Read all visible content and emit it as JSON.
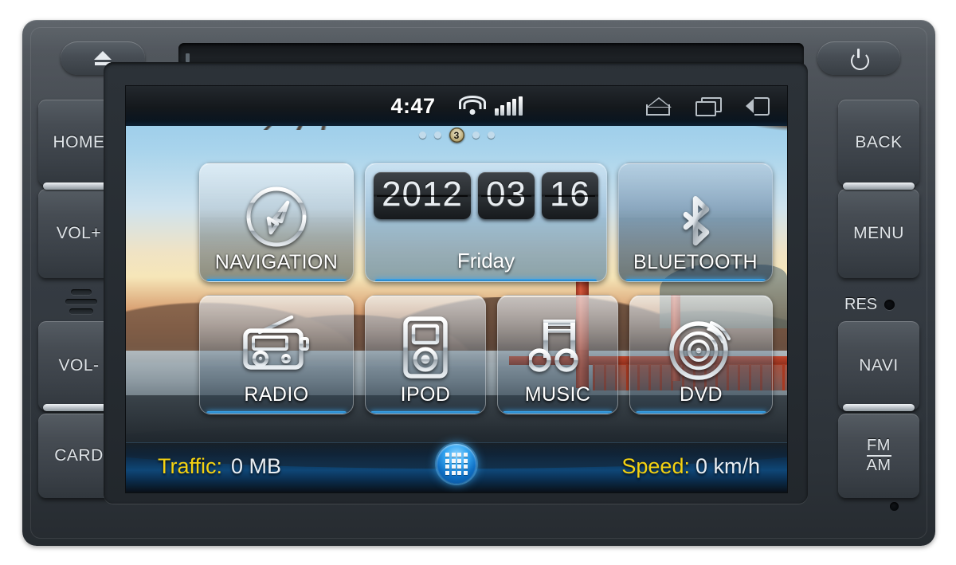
{
  "device": {
    "top_bar": {
      "eject_label": "eject-icon",
      "power_label": "power-icon",
      "disc_slot": "disc-slot"
    },
    "left_buttons": [
      {
        "label": "HOME"
      },
      {
        "label": "VOL+"
      },
      {
        "label": "VOL-"
      },
      {
        "label": "CARD"
      }
    ],
    "right_buttons": [
      {
        "label": "BACK"
      },
      {
        "label": "MENU"
      },
      {
        "label": "NAVI"
      },
      {
        "label": "FM",
        "label2": "AM"
      }
    ],
    "reset": {
      "label": "RES"
    }
  },
  "screen": {
    "statusbar": {
      "time": "4:47",
      "wifi_icon": "wifi-icon",
      "signal_icon": "signal-bars-icon",
      "signal_bars": [
        9,
        13,
        17,
        21,
        24
      ],
      "home_icon": "home-icon",
      "recent_icon": "recent-apps-icon",
      "back_icon": "back-icon"
    },
    "page_indicator": {
      "total": 5,
      "current": 3,
      "current_label": "3"
    },
    "tiles": [
      {
        "id": "navigation",
        "label": "NAVIGATION",
        "icon": "compass-icon"
      },
      {
        "id": "date",
        "label": "",
        "icon": "flip-clock-widget"
      },
      {
        "id": "bluetooth",
        "label": "BLUETOOTH",
        "icon": "bluetooth-icon"
      },
      {
        "id": "radio",
        "label": "RADIO",
        "icon": "radio-icon"
      },
      {
        "id": "ipod",
        "label": "IPOD",
        "icon": "ipod-icon"
      },
      {
        "id": "music",
        "label": "MUSIC",
        "icon": "music-note-icon"
      },
      {
        "id": "dvd",
        "label": "DVD",
        "icon": "disc-icon"
      }
    ],
    "date_widget": {
      "year": "2012",
      "month": "03",
      "day": "16",
      "weekday": "Friday"
    },
    "bottombar": {
      "traffic_label": "Traffic:",
      "traffic_value": "0 MB",
      "speed_label": "Speed:",
      "speed_value": "0 km/h",
      "drawer_icon": "app-drawer-icon"
    }
  },
  "colors": {
    "accent_blue": "#3ea9f0",
    "label_yellow": "#f5d211",
    "value_white": "#e9eef2",
    "bezel_dark": "#2c3238"
  }
}
